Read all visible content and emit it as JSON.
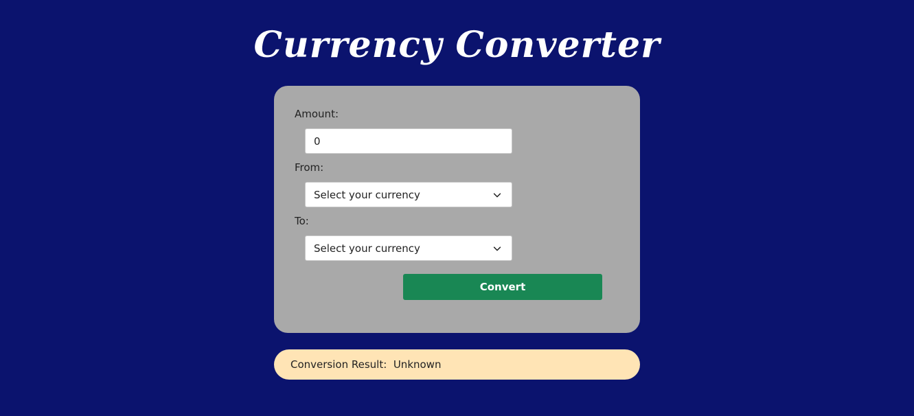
{
  "page": {
    "title": "Currency Converter"
  },
  "form": {
    "amount_label": "Amount:",
    "amount_value": "0",
    "from_label": "From:",
    "from_selected": "Select your currency",
    "to_label": "To:",
    "to_selected": "Select your currency",
    "convert_label": "Convert"
  },
  "result": {
    "label": "Conversion Result:",
    "value": "Unknown"
  },
  "colors": {
    "background": "#0b136e",
    "card": "#a9a9a9",
    "button": "#198754",
    "result_bg": "#ffe4b5"
  },
  "icons": {
    "dropdown": "chevron-down-icon"
  }
}
